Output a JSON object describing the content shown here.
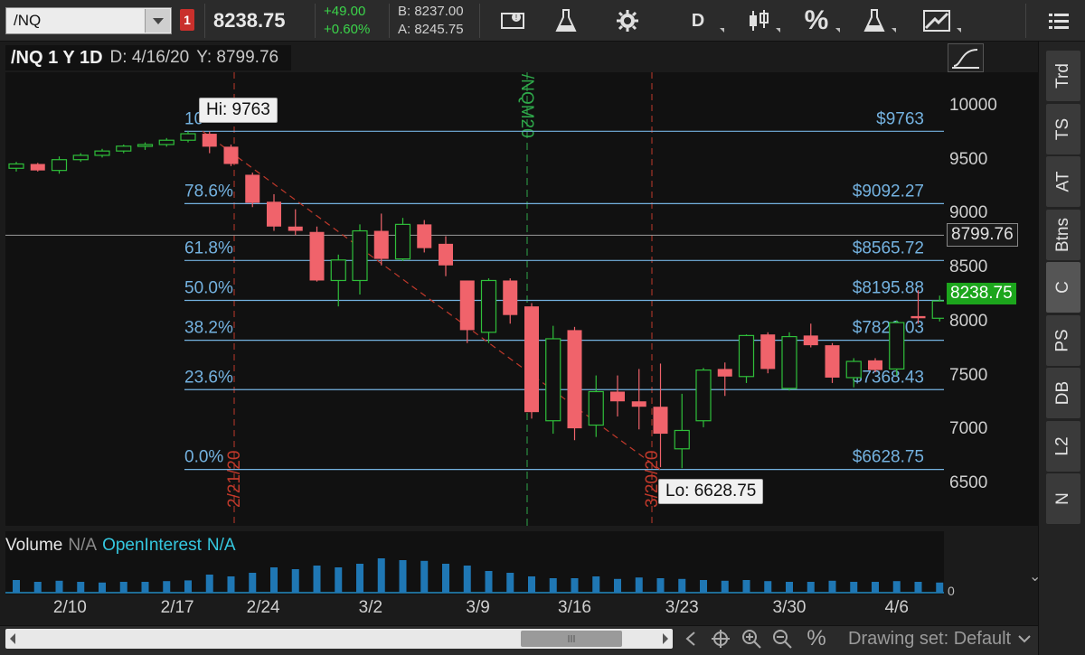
{
  "toolbar": {
    "symbol": "/NQ",
    "link_badge": "1",
    "last_price": "8238.75",
    "change_abs": "+49.00",
    "change_pct": "+0.60%",
    "bid": "B: 8237.00",
    "ask": "A: 8245.75",
    "period_button": "D",
    "percent_button": "%"
  },
  "chart_header": {
    "symbol_period": "/NQ 1 Y 1D",
    "date": "D: 4/16/20",
    "y_value": "Y: 8799.76"
  },
  "price_axis": {
    "ticks": [
      "10000",
      "9500",
      "9000",
      "8500",
      "8000",
      "7500",
      "7000",
      "6500"
    ],
    "y_tag": "8799.76",
    "last_tag": "8238.75"
  },
  "time_axis": {
    "ticks": [
      "2/10",
      "2/17",
      "2/24",
      "3/2",
      "3/9",
      "3/16",
      "3/23",
      "3/30",
      "4/6"
    ]
  },
  "fibonacci": {
    "levels": [
      {
        "pct": "10",
        "price": "$9763",
        "value": 9763
      },
      {
        "pct": "78.6%",
        "price": "$9092.27",
        "value": 9092.27
      },
      {
        "pct": "61.8%",
        "price": "$8565.72",
        "value": 8565.72
      },
      {
        "pct": "50.0%",
        "price": "$8195.88",
        "value": 8195.88
      },
      {
        "pct": "38.2%",
        "price": "$7826.03",
        "value": 7826.03
      },
      {
        "pct": "23.6%",
        "price": "$7368.43",
        "value": 7368.43
      },
      {
        "pct": "0.0%",
        "price": "$6628.75",
        "value": 6628.75
      }
    ]
  },
  "callouts": {
    "hi": "Hi: 9763",
    "lo": "Lo: 6628.75"
  },
  "vertical_markers": {
    "start": "2/21/20",
    "rollover": "/NQM20",
    "end": "3/20/20"
  },
  "volume_header": {
    "volume_label": "Volume",
    "volume_value": "N/A",
    "oi_label": "OpenInterest",
    "oi_value": "N/A"
  },
  "volume_axis_zero": "0",
  "sidebar": {
    "tabs": [
      "Trd",
      "TS",
      "AT",
      "Btns",
      "C",
      "PS",
      "DB",
      "L2",
      "N"
    ],
    "active": "C"
  },
  "bottom": {
    "drawing_set": "Drawing set: Default",
    "percent_icon": "%"
  },
  "colors": {
    "up": "#2fbf3a",
    "down": "#f0636b",
    "fib_line": "#74b2e0",
    "marker": "#c0392b",
    "rollover": "#2ea84a"
  },
  "chart_data": {
    "type": "candlestick",
    "candles": [
      {
        "o": 9420,
        "h": 9480,
        "l": 9390,
        "c": 9460
      },
      {
        "o": 9460,
        "h": 9470,
        "l": 9390,
        "c": 9400
      },
      {
        "o": 9400,
        "h": 9530,
        "l": 9370,
        "c": 9500
      },
      {
        "o": 9500,
        "h": 9560,
        "l": 9480,
        "c": 9540
      },
      {
        "o": 9540,
        "h": 9600,
        "l": 9520,
        "c": 9580
      },
      {
        "o": 9580,
        "h": 9640,
        "l": 9560,
        "c": 9625
      },
      {
        "o": 9625,
        "h": 9660,
        "l": 9590,
        "c": 9640
      },
      {
        "o": 9640,
        "h": 9700,
        "l": 9620,
        "c": 9680
      },
      {
        "o": 9680,
        "h": 9763,
        "l": 9660,
        "c": 9740
      },
      {
        "o": 9740,
        "h": 9760,
        "l": 9560,
        "c": 9620
      },
      {
        "o": 9620,
        "h": 9640,
        "l": 9440,
        "c": 9460
      },
      {
        "o": 9360,
        "h": 9380,
        "l": 9060,
        "c": 9100
      },
      {
        "o": 9110,
        "h": 9180,
        "l": 8840,
        "c": 8880
      },
      {
        "o": 8880,
        "h": 9040,
        "l": 8800,
        "c": 8840
      },
      {
        "o": 8830,
        "h": 8880,
        "l": 8370,
        "c": 8380
      },
      {
        "o": 8380,
        "h": 8620,
        "l": 8140,
        "c": 8570
      },
      {
        "o": 8380,
        "h": 8900,
        "l": 8250,
        "c": 8840
      },
      {
        "o": 8840,
        "h": 9000,
        "l": 8520,
        "c": 8580
      },
      {
        "o": 8580,
        "h": 8960,
        "l": 8560,
        "c": 8900
      },
      {
        "o": 8900,
        "h": 8940,
        "l": 8640,
        "c": 8680
      },
      {
        "o": 8720,
        "h": 8790,
        "l": 8420,
        "c": 8520
      },
      {
        "o": 8380,
        "h": 8380,
        "l": 7800,
        "c": 7920
      },
      {
        "o": 7900,
        "h": 8400,
        "l": 7800,
        "c": 8380
      },
      {
        "o": 8380,
        "h": 8400,
        "l": 7980,
        "c": 8060
      },
      {
        "o": 8140,
        "h": 8170,
        "l": 7100,
        "c": 7160
      },
      {
        "o": 7080,
        "h": 7960,
        "l": 6960,
        "c": 7840
      },
      {
        "o": 7920,
        "h": 7950,
        "l": 6900,
        "c": 7010
      },
      {
        "o": 7040,
        "h": 7500,
        "l": 6930,
        "c": 7350
      },
      {
        "o": 7350,
        "h": 7500,
        "l": 7120,
        "c": 7260
      },
      {
        "o": 7260,
        "h": 7560,
        "l": 7000,
        "c": 7210
      },
      {
        "o": 7210,
        "h": 7610,
        "l": 6650,
        "c": 6960
      },
      {
        "o": 6820,
        "h": 7330,
        "l": 6640,
        "c": 6990
      },
      {
        "o": 7080,
        "h": 7570,
        "l": 7020,
        "c": 7550
      },
      {
        "o": 7560,
        "h": 7620,
        "l": 7310,
        "c": 7490
      },
      {
        "o": 7490,
        "h": 7880,
        "l": 7430,
        "c": 7870
      },
      {
        "o": 7880,
        "h": 7900,
        "l": 7520,
        "c": 7560
      },
      {
        "o": 7380,
        "h": 7900,
        "l": 7360,
        "c": 7860
      },
      {
        "o": 7870,
        "h": 7980,
        "l": 7760,
        "c": 7780
      },
      {
        "o": 7780,
        "h": 7800,
        "l": 7430,
        "c": 7480
      },
      {
        "o": 7480,
        "h": 7660,
        "l": 7390,
        "c": 7630
      },
      {
        "o": 7640,
        "h": 7660,
        "l": 7530,
        "c": 7550
      },
      {
        "o": 7560,
        "h": 8010,
        "l": 7500,
        "c": 7990
      },
      {
        "o": 8050,
        "h": 8290,
        "l": 7980,
        "c": 8030
      },
      {
        "o": 8030,
        "h": 8240,
        "l": 8000,
        "c": 8190
      },
      {
        "o": 8190,
        "h": 8290,
        "l": 8130,
        "c": 8238.75
      }
    ],
    "volume_levels": [
      0.35,
      0.3,
      0.33,
      0.3,
      0.28,
      0.3,
      0.3,
      0.32,
      0.34,
      0.5,
      0.45,
      0.55,
      0.7,
      0.65,
      0.75,
      0.7,
      0.8,
      0.95,
      0.9,
      0.88,
      0.8,
      0.75,
      0.6,
      0.55,
      0.45,
      0.4,
      0.4,
      0.45,
      0.38,
      0.42,
      0.4,
      0.38,
      0.35,
      0.33,
      0.35,
      0.32,
      0.3,
      0.3,
      0.33,
      0.3,
      0.3,
      0.32,
      0.3,
      0.28,
      0.3
    ],
    "ylim": [
      6100,
      10300
    ]
  }
}
